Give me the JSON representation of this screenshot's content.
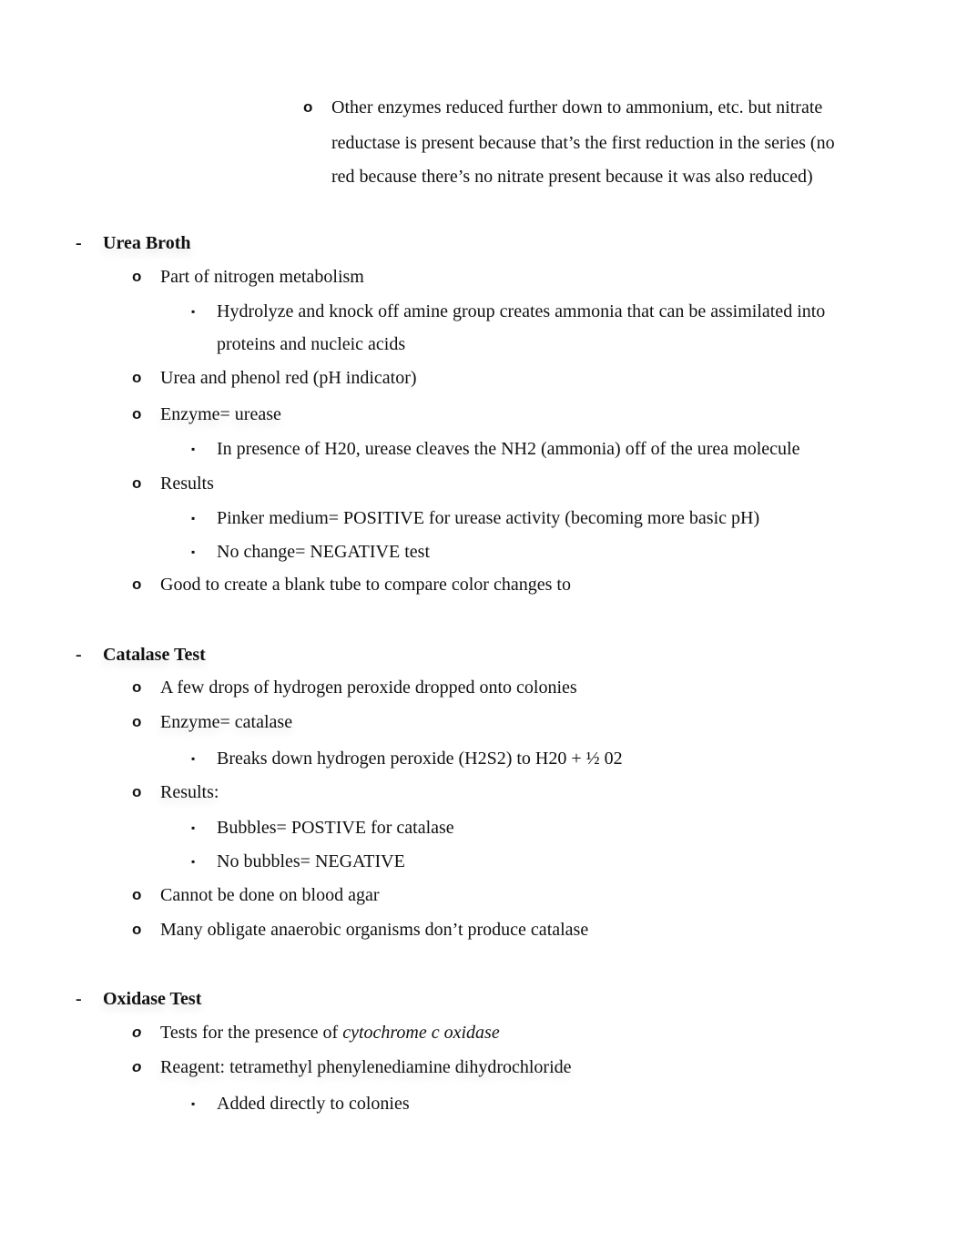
{
  "intro": {
    "lines": [
      "Other enzymes reduced further down to ammonium, etc. but nitrate",
      "reductase is present because that’s the first reduction in the series (no",
      "red because there’s no nitrate present because it was also reduced)"
    ]
  },
  "bullets": {
    "dash": "-",
    "circle": "o",
    "square": "▪"
  },
  "urea": {
    "heading": "Urea Broth",
    "items": [
      "Part of nitrogen metabolism",
      "Hydrolyze and knock off amine group creates ammonia that can be assimilated into",
      "proteins and nucleic acids",
      "Urea and phenol red (pH indicator)",
      "Enzyme= urease",
      "In presence of H20, urease cleaves the NH2 (ammonia) off of the urea molecule",
      "Results",
      "Pinker medium= POSITIVE for urease activity (becoming more basic pH)",
      "No change= NEGATIVE test",
      "Good to create a blank tube to compare color changes to"
    ]
  },
  "catalase": {
    "heading": "Catalase Test",
    "items": [
      "A few drops of hydrogen peroxide dropped onto colonies",
      "Enzyme= catalase",
      "Breaks down hydrogen peroxide (H2S2) to H20 + ½ 02",
      "Results:",
      "Bubbles= POSTIVE for catalase",
      "No bubbles= NEGATIVE",
      "Cannot be done on blood agar",
      "Many obligate anaerobic organisms don’t produce catalase"
    ]
  },
  "oxidase": {
    "heading": "Oxidase Test",
    "items": [
      "Tests for the presence of ",
      "cytochrome c oxidase",
      "Reagent: tetramethyl phenylenediamine dihydrochloride",
      "Added directly to colonies"
    ]
  }
}
